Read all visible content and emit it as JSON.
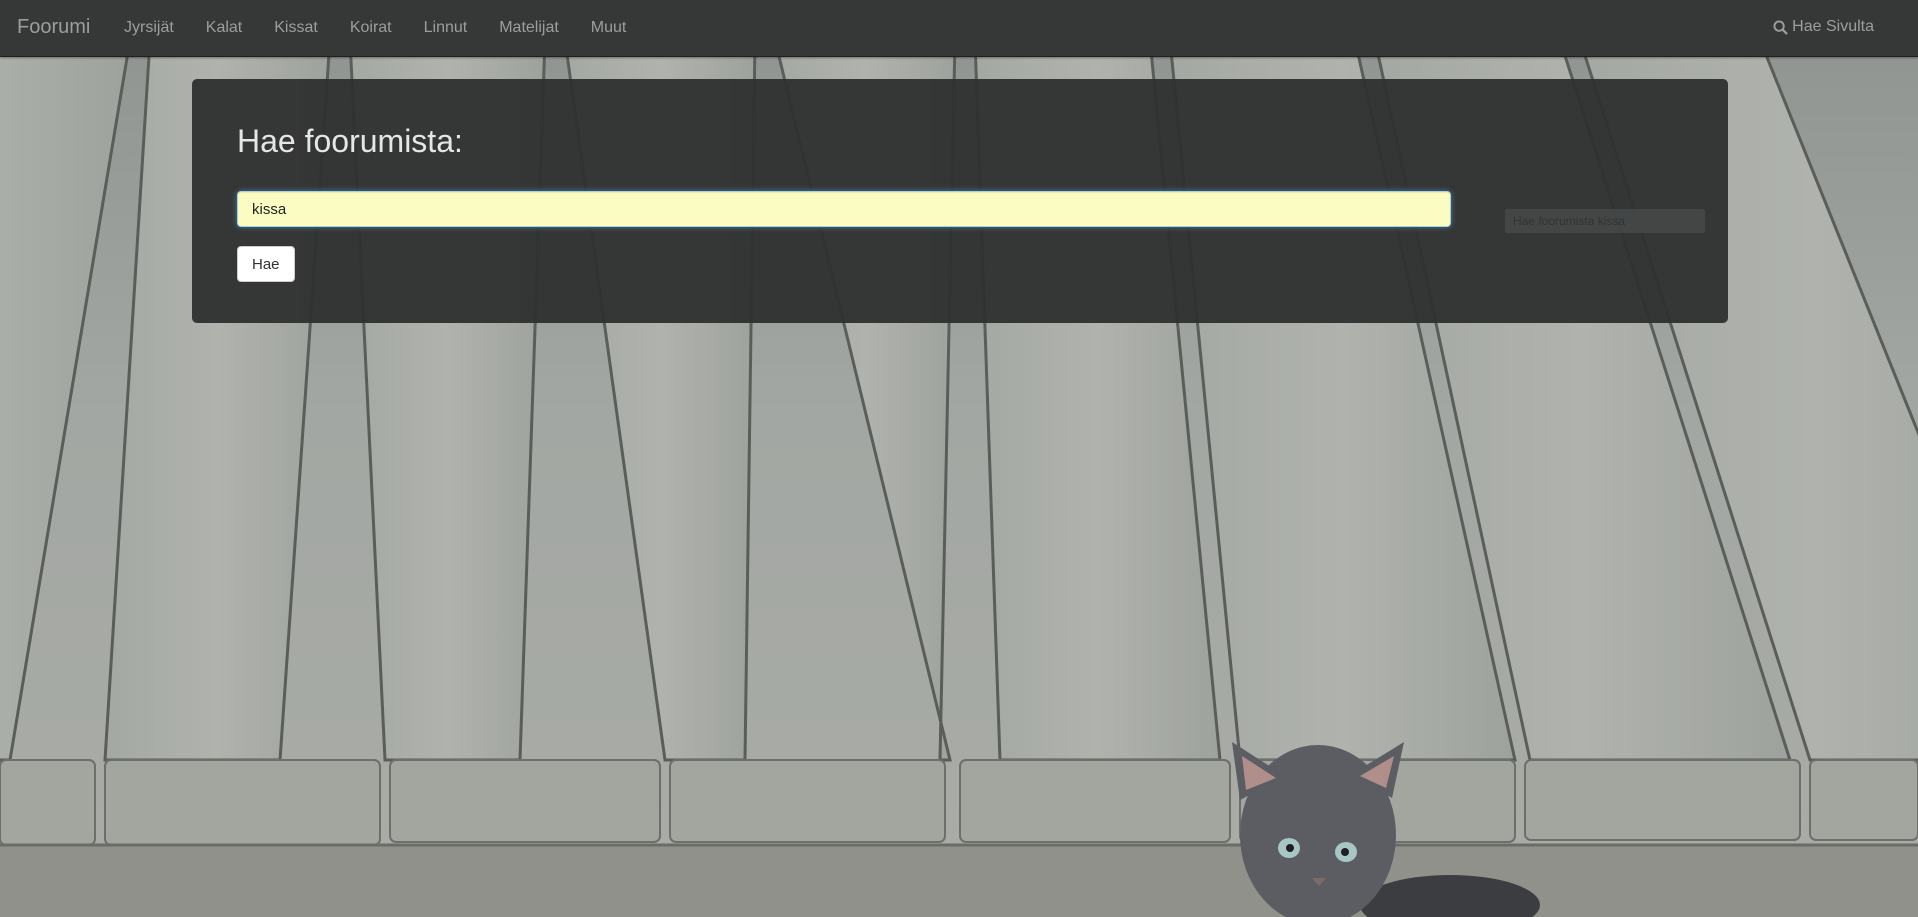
{
  "nav": {
    "brand": "Foorumi",
    "links": [
      "Jyrsijät",
      "Kalat",
      "Kissat",
      "Koirat",
      "Linnut",
      "Matelijat",
      "Muut"
    ],
    "search_label": "Hae Sivulta"
  },
  "search": {
    "heading": "Hae foorumista:",
    "value": "kissa",
    "button_label": "Hae",
    "hint": "Hae foorumista kissa"
  },
  "colors": {
    "navbar": "#363838",
    "panel": "#303131",
    "input_bg": "#fafcc2"
  }
}
